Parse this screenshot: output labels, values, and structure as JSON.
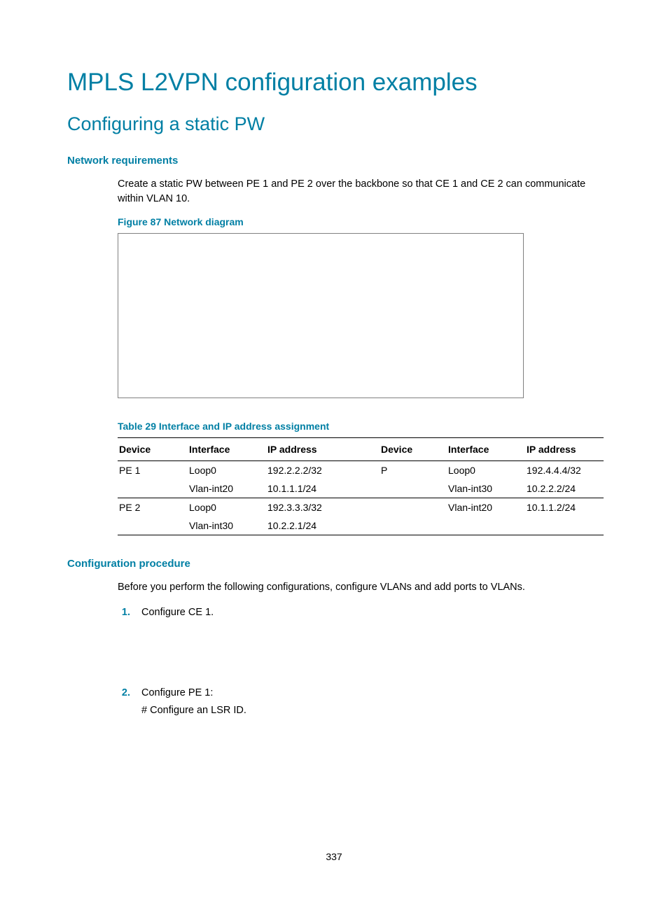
{
  "page_title": "MPLS L2VPN configuration examples",
  "section_title": "Configuring a static PW",
  "subsection1": "Network requirements",
  "body1": "Create a static PW between PE 1 and PE 2 over the backbone so that CE 1 and CE 2 can communicate within VLAN 10.",
  "figure_caption": "Figure 87 Network diagram",
  "table_caption": "Table 29 Interface and IP address assignment",
  "table": {
    "headers": [
      "Device",
      "Interface",
      "IP address",
      "Device",
      "Interface",
      "IP address"
    ],
    "rows": [
      [
        "PE 1",
        "Loop0",
        "192.2.2.2/32",
        "P",
        "Loop0",
        "192.4.4.4/32"
      ],
      [
        "",
        "Vlan-int20",
        "10.1.1.1/24",
        "",
        "Vlan-int30",
        "10.2.2.2/24"
      ],
      [
        "PE 2",
        "Loop0",
        "192.3.3.3/32",
        "",
        "Vlan-int20",
        "10.1.1.2/24"
      ],
      [
        "",
        "Vlan-int30",
        "10.2.2.1/24",
        "",
        "",
        ""
      ]
    ]
  },
  "subsection2": "Configuration procedure",
  "body2": "Before you perform the following configurations, configure VLANs and add ports to VLANs.",
  "steps": {
    "s1": "Configure CE 1.",
    "s2": "Configure PE 1:",
    "s2sub": "# Configure an LSR ID."
  },
  "page_number": "337"
}
